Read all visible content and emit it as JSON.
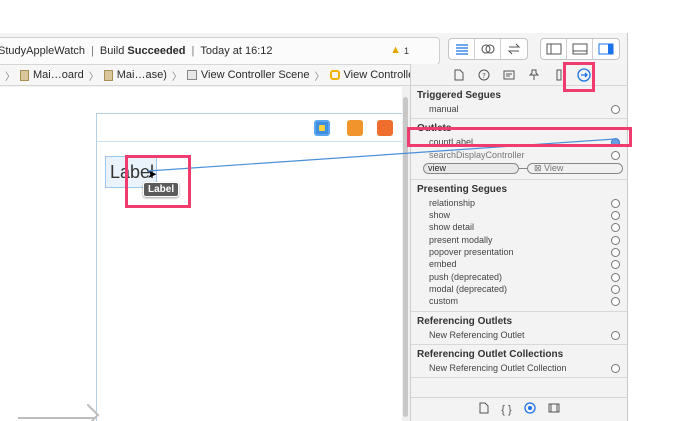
{
  "toolbar": {
    "project": "StudyAppleWatch",
    "build_prefix": "Build",
    "build_status": "Succeeded",
    "time": "Today at 16:12",
    "warning_count": "1"
  },
  "jumpbar": {
    "items": [
      "Mai…oard",
      "Mai…ase)",
      "View Controller Scene",
      "View Controller"
    ]
  },
  "canvas": {
    "label_text": "Label",
    "tooltip_text": "Label"
  },
  "inspector": {
    "triggered_segues": {
      "title": "Triggered Segues",
      "rows": [
        "manual"
      ]
    },
    "outlets": {
      "title": "Outlets",
      "rows": [
        "countLabel",
        "searchDisplayController"
      ],
      "view_label": "view",
      "view_target": "View"
    },
    "presenting_segues": {
      "title": "Presenting Segues",
      "rows": [
        "relationship",
        "show",
        "show detail",
        "present modally",
        "popover presentation",
        "embed",
        "push (deprecated)",
        "modal (deprecated)",
        "custom"
      ]
    },
    "referencing_outlets": {
      "title": "Referencing Outlets",
      "rows": [
        "New Referencing Outlet"
      ]
    },
    "referencing_outlet_collections": {
      "title": "Referencing Outlet Collections",
      "rows": [
        "New Referencing Outlet Collection"
      ]
    }
  },
  "colors": {
    "highlight": "#ef3b6d",
    "accent": "#1a73e8",
    "connection_line": "#4a90d9"
  }
}
